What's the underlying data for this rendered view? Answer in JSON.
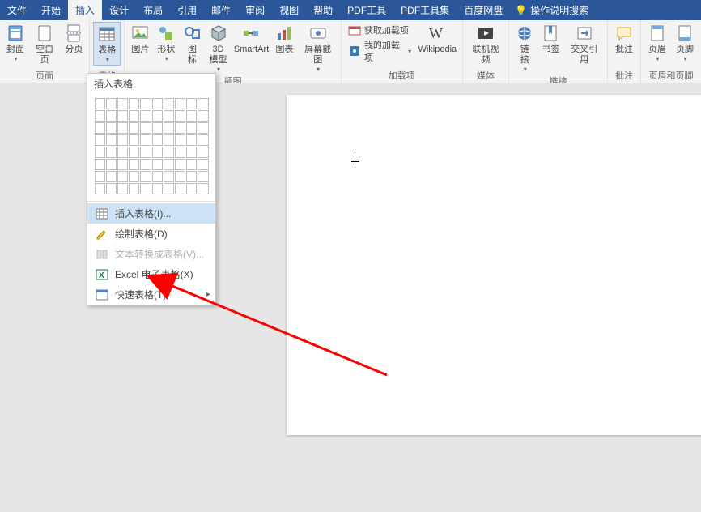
{
  "tabs": {
    "file": "文件",
    "home": "开始",
    "insert": "插入",
    "design": "设计",
    "layout": "布局",
    "references": "引用",
    "mailings": "邮件",
    "review": "审阅",
    "view": "视图",
    "help": "帮助",
    "pdftool": "PDF工具",
    "pdfset": "PDF工具集",
    "baidu": "百度网盘",
    "tellme": "操作说明搜索"
  },
  "ribbon": {
    "pages": {
      "cover": "封面",
      "blank": "空白页",
      "break": "分页",
      "label": "页面"
    },
    "tables": {
      "table": "表格",
      "label": "表格"
    },
    "illust": {
      "pic": "图片",
      "shapes": "形状",
      "icons": "图\n标",
      "model": "3D\n模型",
      "smartart": "SmartArt",
      "chart": "图表",
      "screenshot": "屏幕截图",
      "label": "插图"
    },
    "addins": {
      "get": "获取加载项",
      "my": "我的加载项",
      "wiki": "Wikipedia",
      "label": "加载项"
    },
    "media": {
      "video": "联机视频",
      "label": "媒体"
    },
    "links": {
      "link": "链\n接",
      "bookmark": "书签",
      "crossref": "交叉引用",
      "label": "链接"
    },
    "comments": {
      "comment": "批注",
      "label": "批注"
    },
    "headerfooter": {
      "header": "页眉",
      "footer": "页脚",
      "label": "页眉和页脚"
    }
  },
  "dropdown": {
    "title": "插入表格",
    "insert": "插入表格(I)...",
    "draw": "绘制表格(D)",
    "convert": "文本转换成表格(V)...",
    "excel": "Excel 电子表格(X)",
    "quick": "快速表格(T)"
  }
}
